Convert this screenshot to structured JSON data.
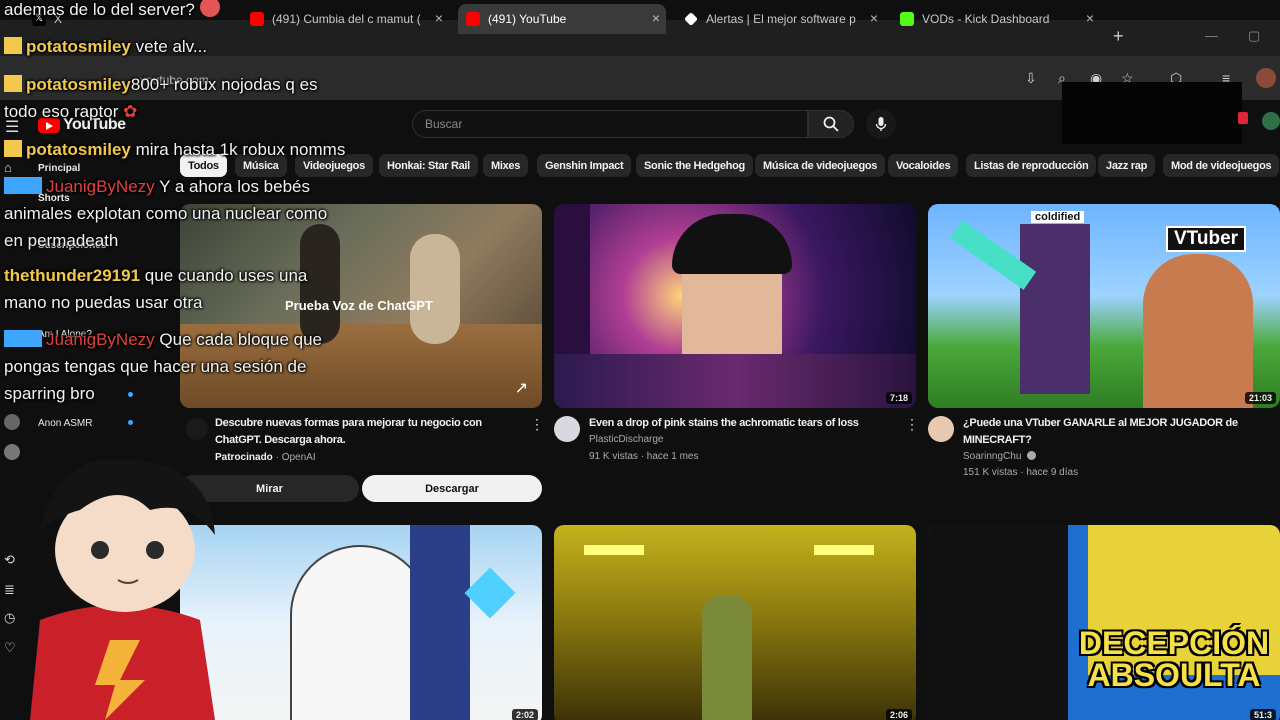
{
  "browser": {
    "tabs": [
      {
        "title": "X",
        "active": false
      },
      {
        "title": "(491) Cumbia del c mamut (",
        "active": false
      },
      {
        "title": "(491) YouTube",
        "active": true
      },
      {
        "title": "Alertas | El mejor software p",
        "active": false
      },
      {
        "title": "VODs - Kick Dashboard",
        "active": false
      }
    ],
    "url": "youtube.com"
  },
  "youtube": {
    "logo_text": "YouTube",
    "search_placeholder": "Buscar",
    "chips": [
      "Todos",
      "Música",
      "Videojuegos",
      "Honkai: Star Rail",
      "Mixes",
      "Genshin Impact",
      "Sonic the Hedgehog",
      "Música de videojuegos",
      "Vocaloides",
      "Listas de reproducción",
      "Jazz rap",
      "Mod de videojuegos"
    ],
    "sidebar": {
      "principal": "Principal",
      "shorts": "Shorts",
      "subscriptions": "Suscripciones",
      "channels": [
        "Am I Alone?",
        "Anon ASMR"
      ]
    },
    "videos": [
      {
        "title_line1": "Descubre nuevas formas para mejorar tu negocio con",
        "title_line2": "ChatGPT. Descarga ahora.",
        "sponsored": "Patrocinado",
        "channel": "OpenAI",
        "thumb_caption": "Prueba Voz de ChatGPT",
        "watch_label": "Mirar",
        "download_label": "Descargar"
      },
      {
        "title_line1": "Even a drop of pink stains the achromatic tears of loss",
        "channel": "PlasticDischarge",
        "meta": "91 K vistas · hace 1 mes",
        "duration": "7:18"
      },
      {
        "title_line1": "¿Puede una VTuber GANARLE al MEJOR JUGADOR de",
        "title_line2": "MINECRAFT?",
        "channel": "SoarinngChu",
        "meta": "151 K vistas · hace 9 días",
        "duration": "21:03",
        "thumb_tag1": "coldified",
        "thumb_tag2": "VTuber"
      },
      {
        "duration": "2:02"
      },
      {
        "duration": "2:06"
      },
      {
        "duration": "51:3",
        "thumb_text1": "DECEPCIÓN",
        "thumb_text2": "ABSOULTA"
      }
    ]
  },
  "chat": [
    {
      "user": "",
      "text": "ademas de lo del server?"
    },
    {
      "user": "potatosmiley",
      "text": "vete alv..."
    },
    {
      "user": "potatosmiley",
      "text": "800+ robux nojodas q es"
    },
    {
      "user": "",
      "text": "todo eso raptor"
    },
    {
      "user": "potatosmiley",
      "text": "mira hasta 1k robux nomms"
    },
    {
      "user": "JuanigByNezy",
      "text": "Y a ahora los bebés"
    },
    {
      "user": "",
      "text": "animales explotan como una nuclear como"
    },
    {
      "user": "",
      "text": "en permadeath"
    },
    {
      "user": "thethunder29191",
      "text": "que cuando uses una"
    },
    {
      "user": "",
      "text": "mano no puedas usar otra"
    },
    {
      "user": "JuanigByNezy",
      "text": "Que cada bloque que"
    },
    {
      "user": "",
      "text": "pongas tengas que hacer una sesión de"
    },
    {
      "user": "",
      "text": "sparring bro"
    }
  ],
  "colors": {
    "accent": "#ff0000",
    "badge_yellow": "#f2c94c",
    "badge_blue": "#3ea6ff",
    "username_red": "#e0413f"
  }
}
